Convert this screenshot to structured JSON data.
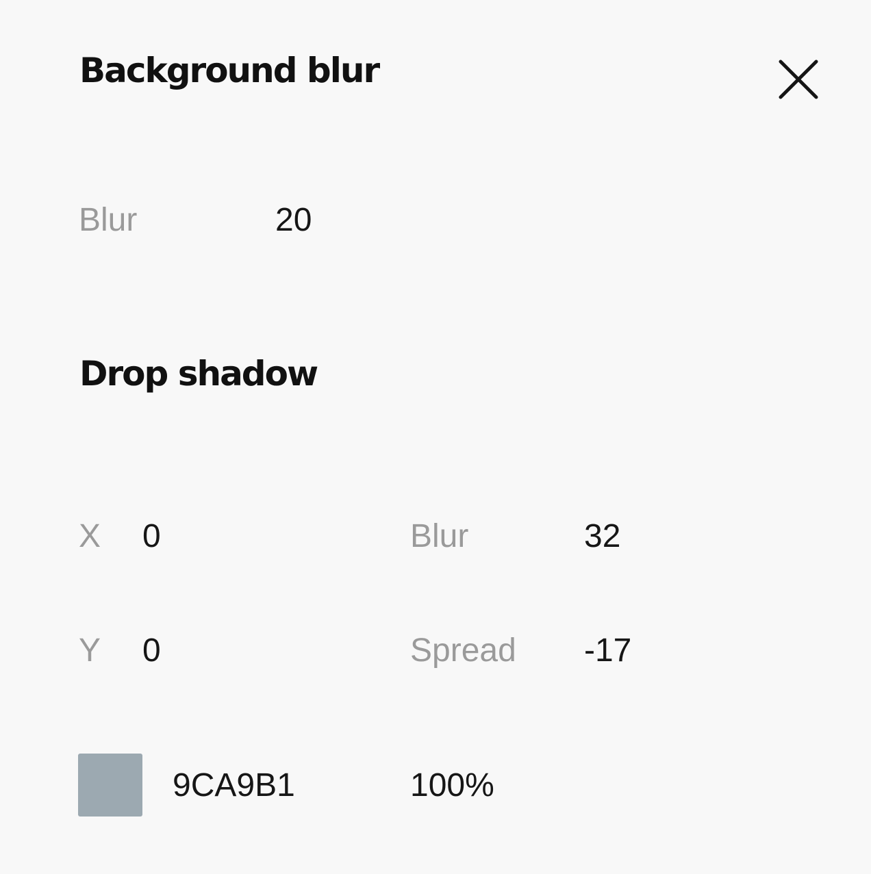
{
  "background_blur": {
    "title": "Background blur",
    "blur_label": "Blur",
    "blur_value": "20"
  },
  "close_icon": "close-icon",
  "drop_shadow": {
    "title": "Drop shadow",
    "x_label": "X",
    "x_value": "0",
    "y_label": "Y",
    "y_value": "0",
    "blur_label": "Blur",
    "blur_value": "32",
    "spread_label": "Spread",
    "spread_value": "-17",
    "color_hex": "9CA9B1",
    "color_swatch": "#9CA9B1",
    "opacity": "100%"
  }
}
